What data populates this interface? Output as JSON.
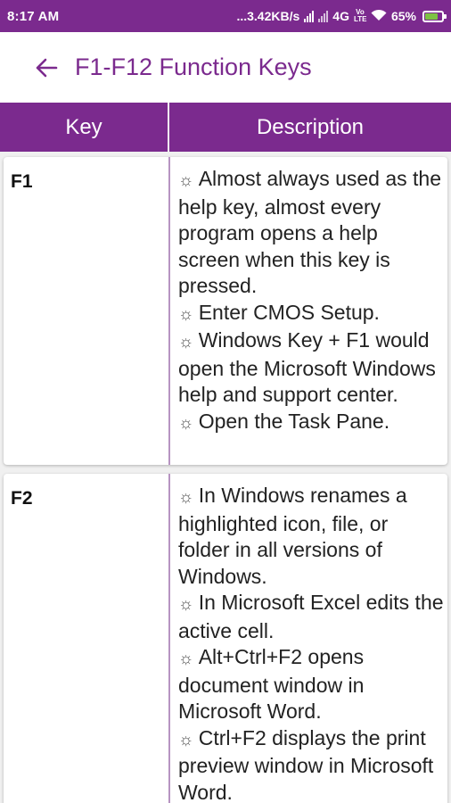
{
  "status_bar": {
    "time": "8:17 AM",
    "network_speed": "...3.42KB/s",
    "network_type": "4G",
    "volte": "Vo LTE",
    "battery": "65%"
  },
  "app_bar": {
    "title": "F1-F12 Function Keys",
    "back_icon": "arrow-left-icon"
  },
  "table": {
    "headers": {
      "key": "Key",
      "description": "Description"
    },
    "rows": [
      {
        "key": "F1",
        "items": [
          "Almost always used as the help key, almost every program opens a help screen when this key is pressed.",
          "Enter CMOS Setup.",
          "Windows Key + F1 would open the Microsoft Windows help and support center.",
          "Open the Task Pane."
        ]
      },
      {
        "key": "F2",
        "items": [
          "In Windows renames a highlighted icon, file, or folder in all versions of Windows.",
          "In Microsoft Excel edits the active cell.",
          "Alt+Ctrl+F2 opens document window in Microsoft Word.",
          "Ctrl+F2 displays the print preview window in Microsoft Word."
        ]
      }
    ]
  },
  "colors": {
    "primary": "#7b2a8e",
    "divider": "#b794c2",
    "background": "#f0f0f0"
  }
}
